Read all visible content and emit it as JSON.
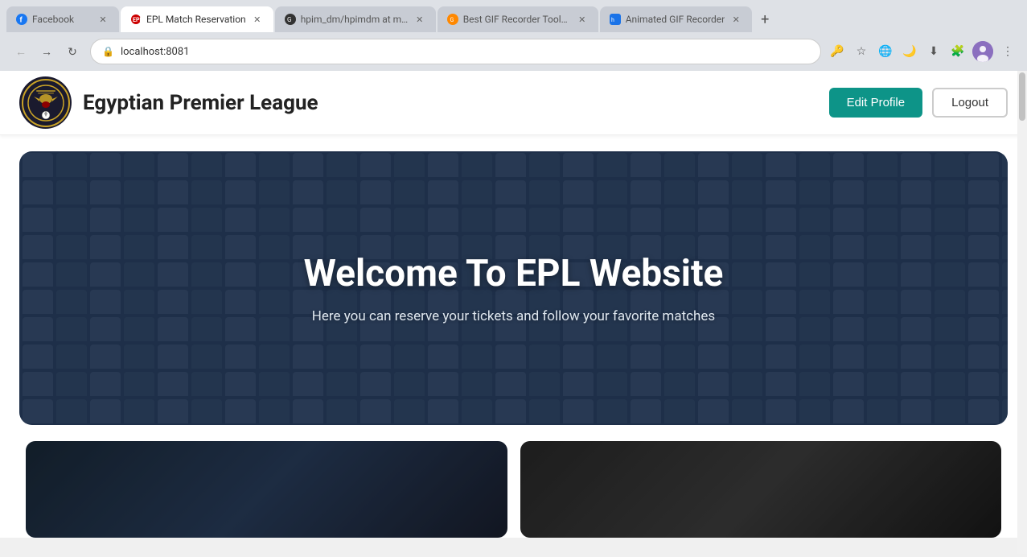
{
  "browser": {
    "url": "localhost:8081",
    "tabs": [
      {
        "id": "tab-facebook",
        "title": "Facebook",
        "favicon_color": "#1877f2",
        "active": false
      },
      {
        "id": "tab-epl",
        "title": "EPL Match Reservation",
        "favicon_color": "#e84040",
        "active": true
      },
      {
        "id": "tab-github",
        "title": "hpim_dm/hpimdm at ma...",
        "favicon_color": "#333",
        "active": false
      },
      {
        "id": "tab-gif-tools",
        "title": "Best GIF Recorder Tools...",
        "favicon_color": "#ff8800",
        "active": false
      },
      {
        "id": "tab-gif-recorder",
        "title": "Animated GIF Recorder",
        "favicon_color": "#1a73e8",
        "active": false
      }
    ]
  },
  "navbar": {
    "brand_name": "Egyptian Premier League",
    "edit_profile_label": "Edit Profile",
    "logout_label": "Logout"
  },
  "hero": {
    "title": "Welcome To EPL Website",
    "subtitle": "Here you can reserve your tickets and follow your favorite matches"
  }
}
